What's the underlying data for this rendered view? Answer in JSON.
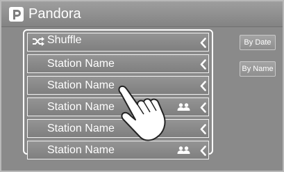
{
  "header": {
    "title": "Pandora",
    "logo_icon": "pandora-logo-icon"
  },
  "list": {
    "items": [
      {
        "label": "Shuffle",
        "icon": "shuffle-icon",
        "shared": false
      },
      {
        "label": "Station Name",
        "shared": false
      },
      {
        "label": "Station Name",
        "shared": false
      },
      {
        "label": "Station Name",
        "shared": true
      },
      {
        "label": "Station Name",
        "shared": false
      },
      {
        "label": "Station Name",
        "shared": true
      }
    ]
  },
  "sort": {
    "by_date": "By Date",
    "by_name": "By Name"
  },
  "colors": {
    "background": "#8a8a8a",
    "text": "#ffffff"
  }
}
